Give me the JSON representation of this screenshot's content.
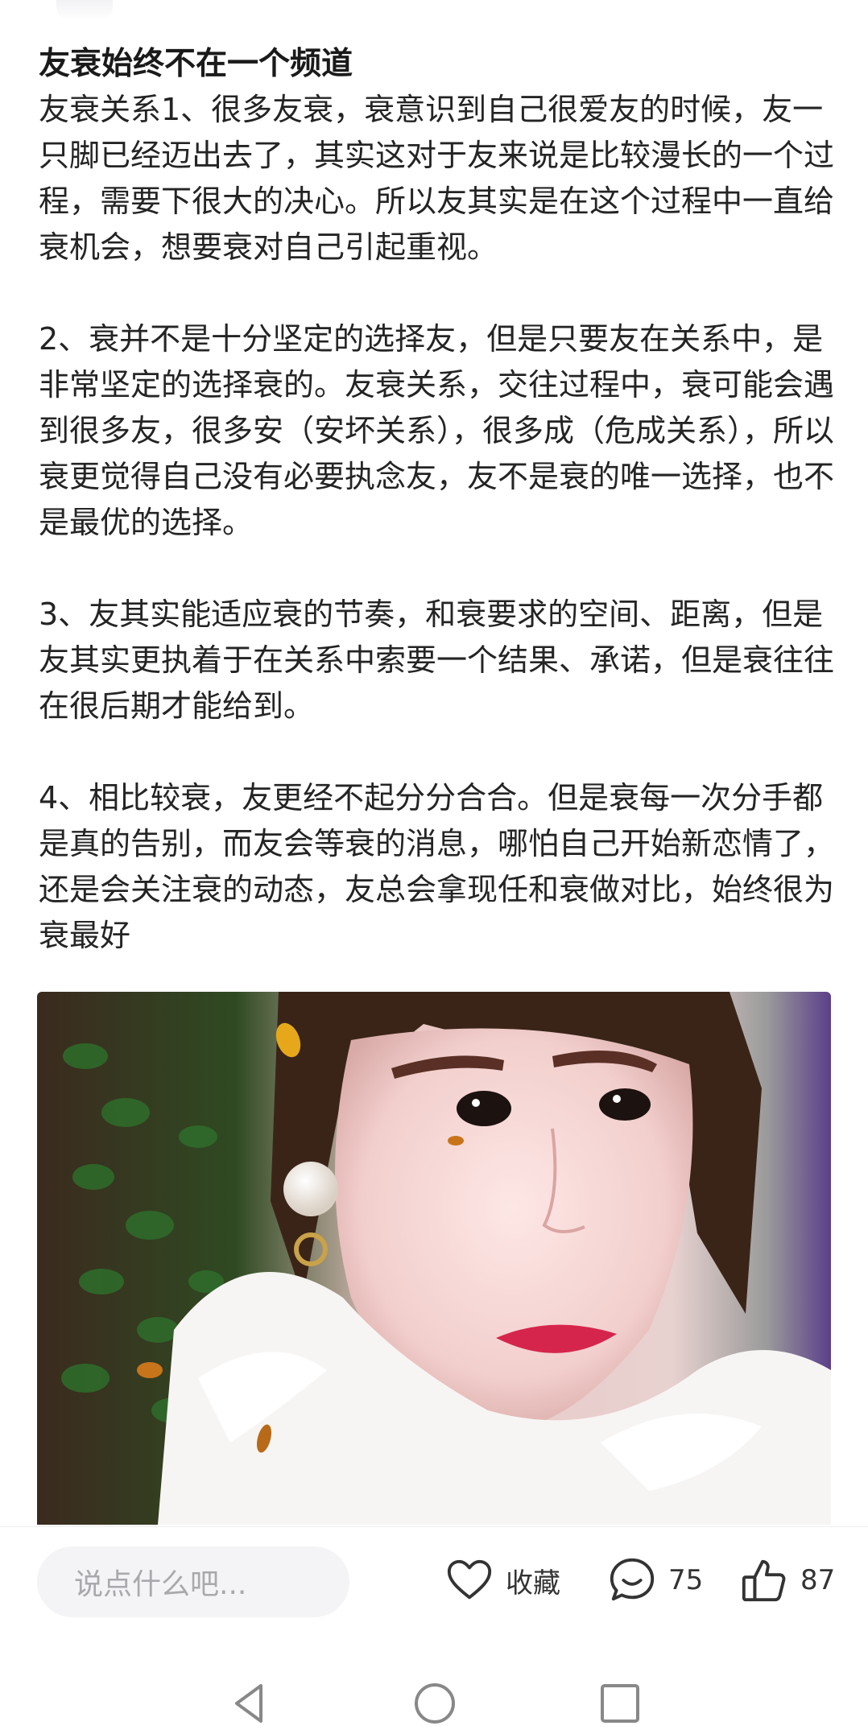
{
  "article": {
    "title": "友衰始终不在一个频道",
    "paragraphs": [
      "友衰关系1、很多友衰，衰意识到自己很爱友的时候，友一只脚已经迈出去了，其实这对于友来说是比较漫长的一个过程，需要下很大的决心。所以友其实是在这个过程中一直给衰机会，想要衰对自己引起重视。",
      "2、衰并不是十分坚定的选择友，但是只要友在关系中，是非常坚定的选择衰的。友衰关系，交往过程中，衰可能会遇到很多友，很多安（安坏关系），很多成（危成关系），所以衰更觉得自己没有必要执念友，友不是衰的唯一选择，也不是最优的选择。",
      "3、友其实能适应衰的节奏，和衰要求的空间、距离，但是友其实更执着于在关系中索要一个结果、承诺，但是衰往往在很后期才能给到。",
      "4、相比较衰，友更经不起分分合合。但是衰每一次分手都是真的告别，而友会等衰的消息，哪怕自己开始新恋情了，还是会关注衰的动态，友总会拿现任和衰做对比，始终很为衰最好"
    ]
  },
  "bottom_bar": {
    "comment_placeholder": "说点什么吧...",
    "collect_label": "收藏",
    "comment_count": "75",
    "like_count": "87"
  },
  "icons": {
    "collect": "heart-icon",
    "comment": "comment-bubble-icon",
    "like": "thumbs-up-icon",
    "nav_back": "triangle-back-icon",
    "nav_home": "circle-home-icon",
    "nav_recent": "square-recent-icon"
  },
  "colors": {
    "text": "#242424",
    "placeholder": "#a9a9ad",
    "input_bg": "#f4f4f6",
    "icon": "#333333"
  }
}
